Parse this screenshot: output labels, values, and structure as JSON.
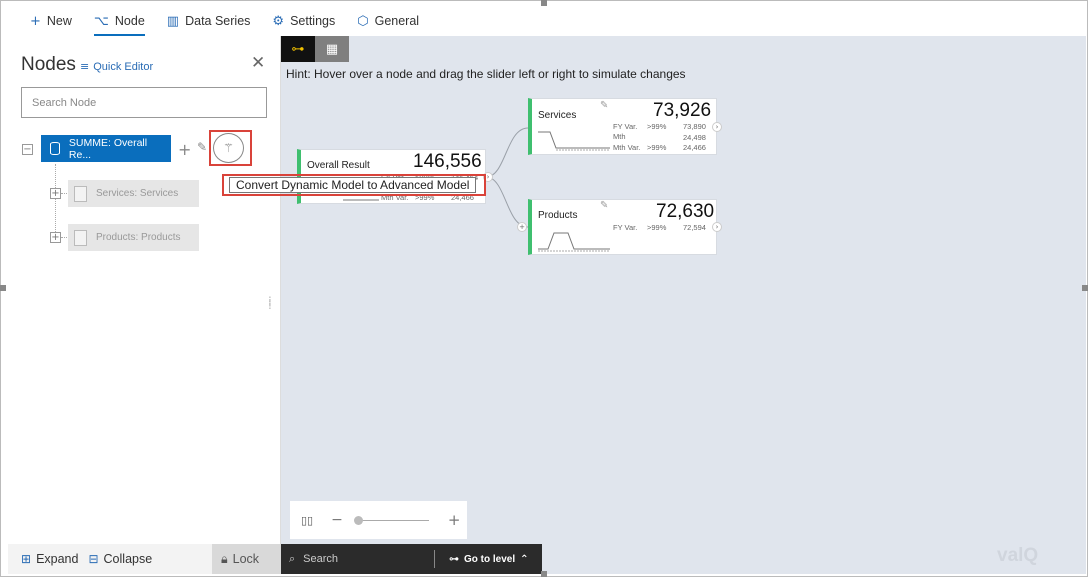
{
  "menu": [
    {
      "icon": "+",
      "label": "New"
    },
    {
      "icon": "⌥",
      "label": "Node"
    },
    {
      "icon": "▥",
      "label": "Data Series"
    },
    {
      "icon": "⚙",
      "label": "Settings"
    },
    {
      "icon": "⬡",
      "label": "General"
    }
  ],
  "panel": {
    "title": "Nodes",
    "quick_editor": "Quick Editor",
    "search_placeholder": "Search Node",
    "root_node": "SUMME: Overall Re...",
    "children": [
      "Services: Services",
      "Products: Products"
    ],
    "expand_label": "Expand",
    "collapse_label": "Collapse",
    "lock_label": "Lock"
  },
  "tooltip": "Convert Dynamic Model to Advanced Model",
  "canvas": {
    "hint": "Hint: Hover over a node and drag the slider left or right to simulate changes",
    "cards": {
      "overall": {
        "name": "Overall Result",
        "value": "146,556",
        "rows": [
          {
            "label": "FY Var.",
            "pct": ">99%",
            "val": "146,464"
          },
          {
            "label": "Mth Var.",
            "pct": ">99%",
            "val": "24,466"
          }
        ]
      },
      "services": {
        "name": "Services",
        "value": "73,926",
        "rows": [
          {
            "label": "FY Var.",
            "pct": ">99%",
            "val": "73,890"
          },
          {
            "label": "Mth",
            "pct": "",
            "val": "24,498"
          },
          {
            "label": "Mth Var.",
            "pct": ">99%",
            "val": "24,466"
          }
        ]
      },
      "products": {
        "name": "Products",
        "value": "72,630",
        "rows": [
          {
            "label": "FY Var.",
            "pct": ">99%",
            "val": "72,594"
          }
        ]
      }
    }
  },
  "bottom": {
    "search_label": "Search",
    "go_to_level": "Go to level"
  },
  "brand": "valQ",
  "colors": {
    "accent": "#0a6ebd",
    "node_status": "#3fbf6f",
    "highlight": "#d9433a",
    "canvas_bg": "#e0e5ed"
  }
}
